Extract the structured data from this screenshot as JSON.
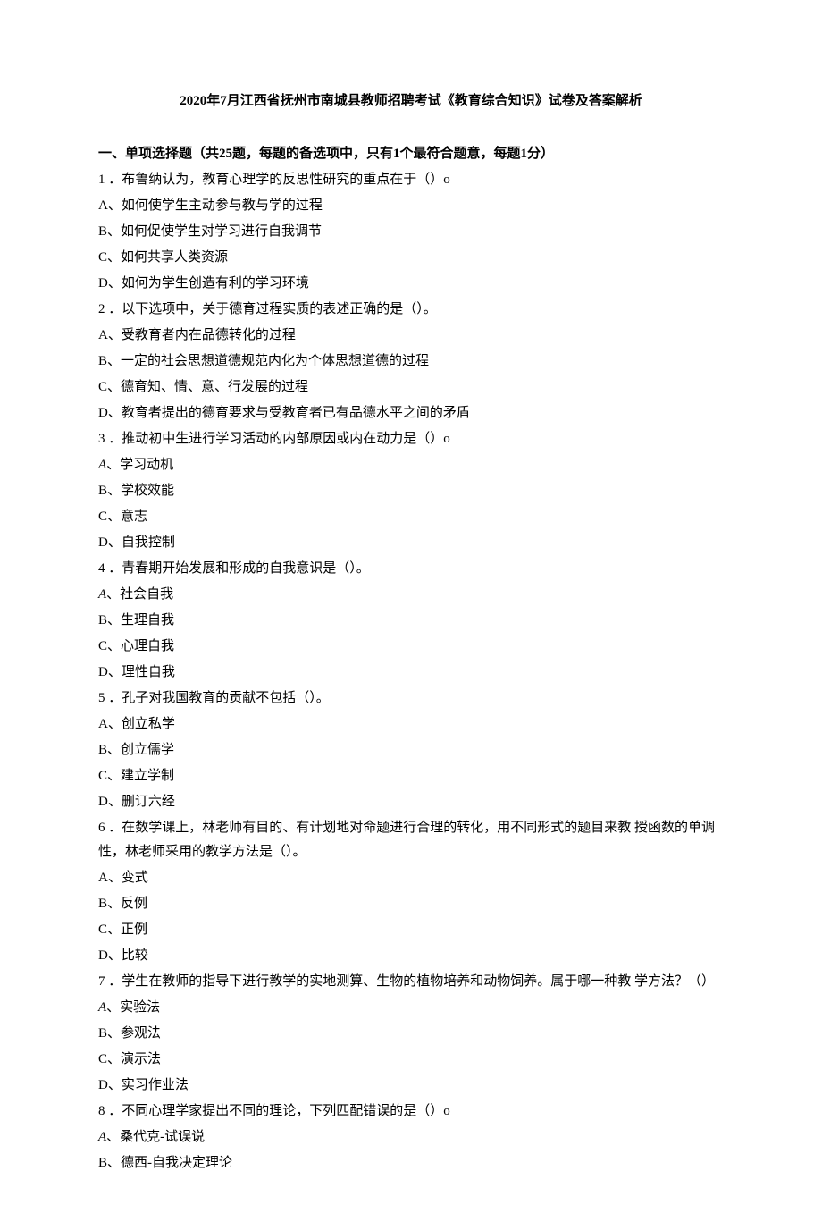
{
  "title": "2020年7月江西省抚州市南城县教师招聘考试《教育综合知识》试卷及答案解析",
  "section_header": "一、单项选择题（共25题，每题的备选项中，只有1个最符合题意，每题1分）",
  "q1": {
    "text": "1 ．布鲁纳认为，教育心理学的反思性研究的重点在于（）o",
    "a": "A、如何使学生主动参与教与学的过程",
    "b": "B、如何促使学生对学习进行自我调节",
    "c": "C、如何共享人类资源",
    "d": "D、如何为学生创造有利的学习环境"
  },
  "q2": {
    "text": "2 ．以下选项中，关于德育过程实质的表述正确的是（）。",
    "a": "A、受教育者内在品德转化的过程",
    "b": "B、一定的社会思想道德规范内化为个体思想道德的过程",
    "c": "C、德育知、情、意、行发展的过程",
    "d": "D、教育者提出的德育要求与受教育者已有品德水平之间的矛盾"
  },
  "q3": {
    "text": "3 ．推动初中生进行学习活动的内部原因或内在动力是（）o",
    "a_prefix": "A",
    "a_suffix": "、学习动机",
    "b": "B、学校效能",
    "c": "C、意志",
    "d": "D、自我控制"
  },
  "q4": {
    "text": "4 ．青春期开始发展和形成的自我意识是（）。",
    "a_prefix": "A",
    "a_suffix": "、社会自我",
    "b": "B、生理自我",
    "c": "C、心理自我",
    "d": "D、理性自我"
  },
  "q5": {
    "text": "5 ．孔子对我国教育的贡献不包括（）。",
    "a": "A、创立私学",
    "b": "B、创立儒学",
    "c": "C、建立学制",
    "d": "D、删订六经"
  },
  "q6": {
    "text": "6 ．在数学课上，林老师有目的、有计划地对命题进行合理的转化，用不同形式的题目来教 授函数的单调性，林老师采用的教学方法是（）。",
    "a": "A、变式",
    "b": "B、反例",
    "c": "C、正例",
    "d": "D、比较"
  },
  "q7": {
    "text": "7 ．学生在教师的指导下进行教学的实地测算、生物的植物培养和动物饲养。属于哪一种教 学方法？（）",
    "a_prefix": "A",
    "a_suffix": "、实验法",
    "b": "B、参观法",
    "c": "C、演示法",
    "d": "D、实习作业法"
  },
  "q8": {
    "text": "8 ．不同心理学家提出不同的理论，下列匹配错误的是（）o",
    "a_prefix": "A",
    "a_suffix": "、桑代克-试误说",
    "b": "B、德西-自我决定理论"
  }
}
